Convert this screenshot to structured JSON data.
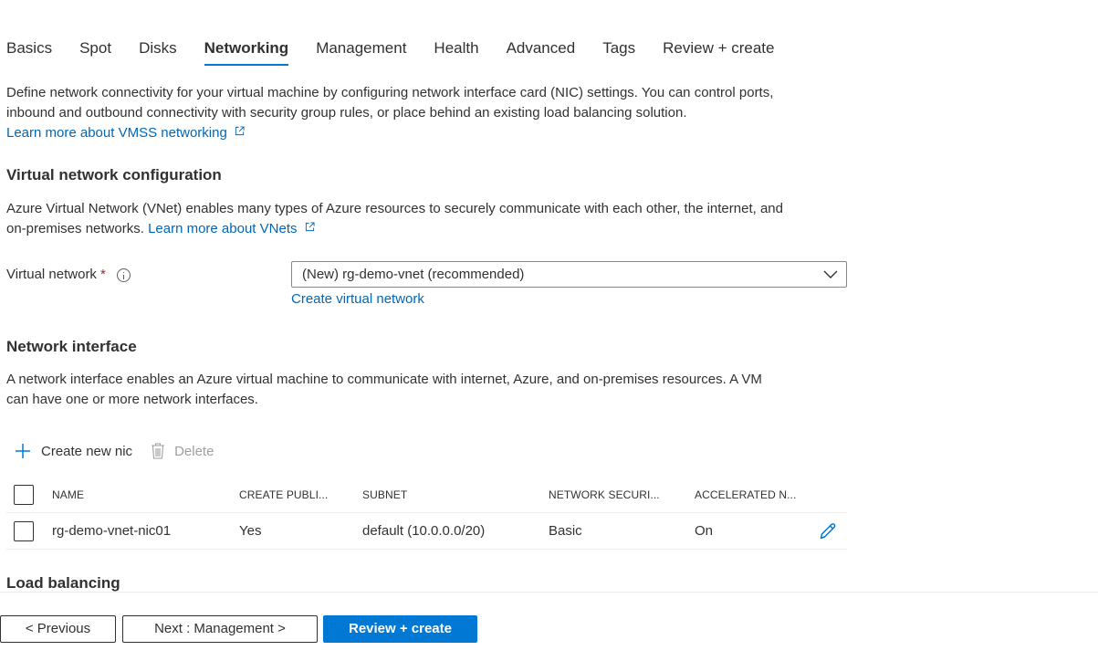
{
  "tabs": [
    {
      "label": "Basics"
    },
    {
      "label": "Spot"
    },
    {
      "label": "Disks"
    },
    {
      "label": "Networking"
    },
    {
      "label": "Management"
    },
    {
      "label": "Health"
    },
    {
      "label": "Advanced"
    },
    {
      "label": "Tags"
    },
    {
      "label": "Review + create"
    }
  ],
  "active_tab": "Networking",
  "intro": {
    "line1": "Define network connectivity for your virtual machine by configuring network interface card (NIC) settings. You can control ports,",
    "line2": "inbound and outbound connectivity with security group rules, or place behind an existing load balancing solution.",
    "link": "Learn more about VMSS networking"
  },
  "vnet_config": {
    "heading": "Virtual network configuration",
    "line1": "Azure Virtual Network (VNet) enables many types of Azure resources to securely communicate with each other, the internet, and",
    "line2": "on-premises networks.",
    "link": "Learn more about VNets",
    "field_label": "Virtual network",
    "required_mark": "*",
    "selected_value": "(New) rg-demo-vnet (recommended)",
    "create_link": "Create virtual network"
  },
  "nic_section": {
    "heading": "Network interface",
    "line1": "A network interface enables an Azure virtual machine to communicate with internet, Azure, and on-premises resources. A VM",
    "line2": "can have one or more network interfaces.",
    "create_label": "Create new nic",
    "delete_label": "Delete",
    "columns": [
      "NAME",
      "CREATE PUBLI...",
      "SUBNET",
      "NETWORK SECURI...",
      "ACCELERATED N..."
    ],
    "rows": [
      {
        "name": "rg-demo-vnet-nic01",
        "public_ip": "Yes",
        "subnet": "default (10.0.0.0/20)",
        "nsg": "Basic",
        "accelerated": "On"
      }
    ]
  },
  "load_balancing": {
    "heading": "Load balancing"
  },
  "footer": {
    "previous": "< Previous",
    "next": "Next : Management >",
    "review": "Review + create"
  },
  "colors": {
    "accent": "#0078d4",
    "link": "#0067b8",
    "required": "#a4262c"
  },
  "icons": [
    "external-link-icon",
    "info-icon",
    "chevron-down-icon",
    "plus-icon",
    "trash-icon",
    "pencil-icon"
  ]
}
